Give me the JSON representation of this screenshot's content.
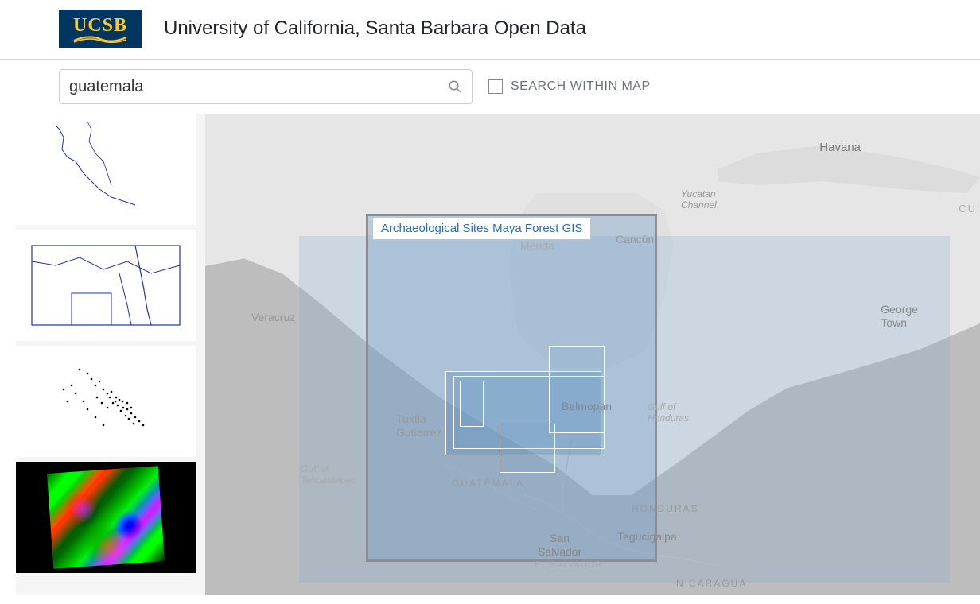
{
  "logo": {
    "text": "UCSB"
  },
  "site_title": "University of California, Santa Barbara Open Data",
  "search": {
    "value": "guatemala",
    "placeholder": "Search"
  },
  "within_map": {
    "label": "SEARCH WITHIN MAP",
    "checked": false
  },
  "sidebar": {
    "thumbnails": [
      {
        "kind": "line-outline"
      },
      {
        "kind": "line-rivers"
      },
      {
        "kind": "points-scatter"
      },
      {
        "kind": "satellite"
      }
    ]
  },
  "map": {
    "tooltip": "Archaeological Sites Maya Forest GIS",
    "labels": {
      "havana": "Havana",
      "yucatan_channel_1": "Yucatan",
      "yucatan_channel_2": "Channel",
      "cancun": "Cancún",
      "merida": "Mérida",
      "veracruz": "Veracruz",
      "george_town_1": "George",
      "george_town_2": "Town",
      "cuba": "CU",
      "belmopan": "Belmopan",
      "tuxtla_1": "Tuxtla",
      "tuxtla_2": "Gutierrez",
      "tehuantepec_1": "Gulf of",
      "tehuantepec_2": "Tehuantepec",
      "guatemala": "GUATEMALA",
      "honduras": "HONDURAS",
      "gulf_honduras_1": "Gulf of",
      "gulf_honduras_2": "Honduras",
      "tegucigalpa": "Tegucigalpa",
      "san_salvador_1": "San",
      "san_salvador_2": "Salvador",
      "el_salvador": "EL SALVADOR",
      "nicaragua": "NICARAGUA"
    }
  }
}
